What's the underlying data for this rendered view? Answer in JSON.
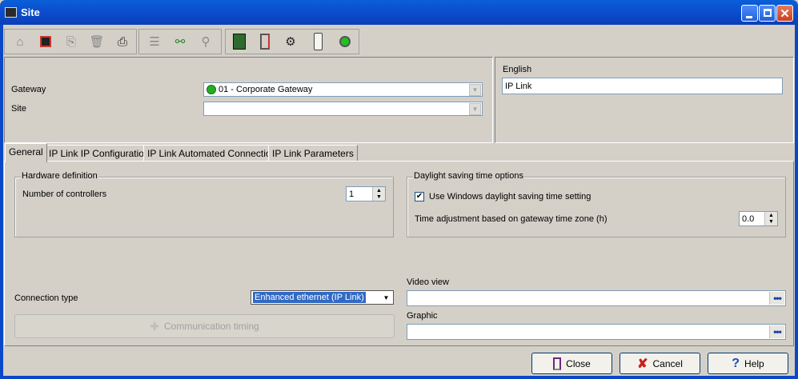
{
  "window": {
    "title": "Site"
  },
  "toolbar": {
    "icons": [
      "new-icon",
      "save-icon",
      "copy-icon",
      "delete-icon",
      "print-icon",
      "list-icon",
      "link-icon",
      "search-icon",
      "controller-board-icon",
      "door-icon",
      "io-module-icon",
      "reader-icon",
      "status-led-icon"
    ]
  },
  "header": {
    "gateway_label": "Gateway",
    "gateway_value": "01 - Corporate Gateway",
    "site_label": "Site",
    "site_value": "",
    "language_label": "English",
    "language_value": "IP Link"
  },
  "tabs": [
    {
      "label": "General"
    },
    {
      "label": "IP Link IP Configuration"
    },
    {
      "label": "IP Link Automated Connection"
    },
    {
      "label": "IP Link Parameters"
    }
  ],
  "hardware": {
    "title": "Hardware definition",
    "controllers_label": "Number of controllers",
    "controllers_value": "1"
  },
  "dst": {
    "title": "Daylight saving time options",
    "checkbox_label": "Use Windows daylight saving time setting",
    "checkbox_checked": true,
    "adjust_label": "Time adjustment based on gateway time zone (h)",
    "adjust_value": "0.0"
  },
  "connection": {
    "label": "Connection type",
    "value": "Enhanced ethernet (IP Link)",
    "timing_button": "Communication timing"
  },
  "video": {
    "label": "Video view",
    "value": ""
  },
  "graphic": {
    "label": "Graphic",
    "value": ""
  },
  "footer": {
    "close": "Close",
    "cancel": "Cancel",
    "help": "Help"
  },
  "colors": {
    "title_bar": "#0a4fd0",
    "face": "#d4d0c8",
    "selection": "#316ac5",
    "status_green": "#22b022"
  }
}
